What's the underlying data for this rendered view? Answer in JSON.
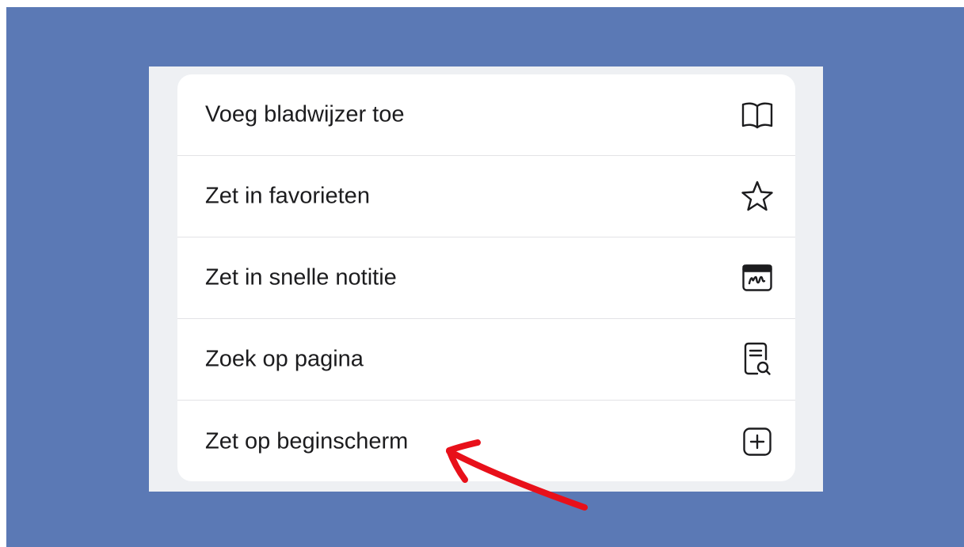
{
  "menu": {
    "items": [
      {
        "label": "Voeg bladwijzer toe",
        "icon": "book-icon"
      },
      {
        "label": "Zet in favorieten",
        "icon": "star-icon"
      },
      {
        "label": "Zet in snelle notitie",
        "icon": "quick-note-icon"
      },
      {
        "label": "Zoek op pagina",
        "icon": "find-on-page-icon"
      },
      {
        "label": "Zet op beginscherm",
        "icon": "add-square-icon"
      }
    ]
  },
  "colors": {
    "background": "#5b79b5",
    "menu_background": "#ffffff",
    "text": "#1c1c1e",
    "annotation_arrow": "#e8101a"
  },
  "annotation": {
    "type": "red-arrow",
    "points_to": "Zet op beginscherm"
  }
}
